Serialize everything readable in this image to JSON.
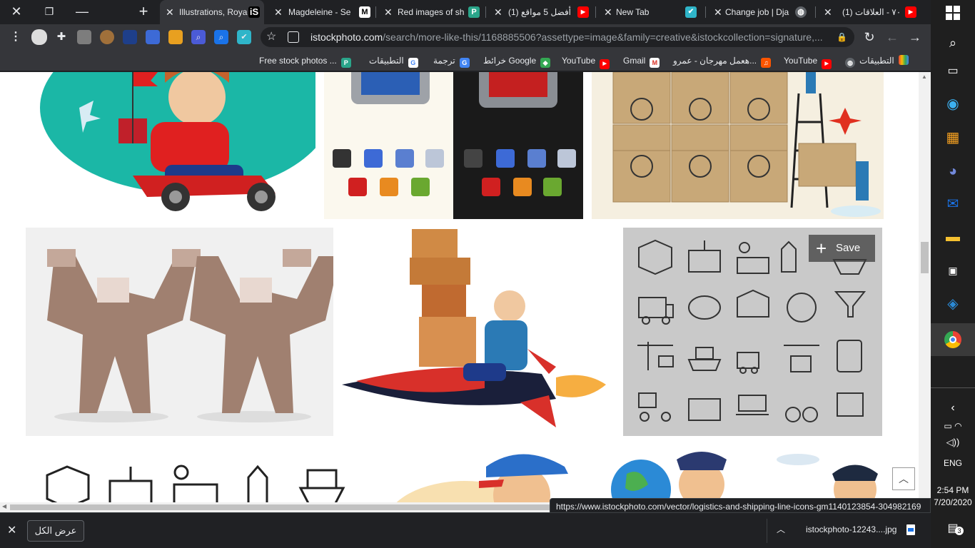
{
  "tabs": [
    {
      "label": "Illustrations, Roya",
      "favicon": "iS",
      "active": true
    },
    {
      "label": "Magdeleine - Se",
      "favicon": "M"
    },
    {
      "label": "Red images of sh",
      "favicon": "p"
    },
    {
      "label": "(1) أفضل 5 مواقع",
      "favicon": "youtube"
    },
    {
      "label": "New Tab",
      "favicon": "none"
    },
    {
      "label": "Change job | Dja",
      "favicon": "globe"
    },
    {
      "label": "(1) ٧٠ - العلاقات",
      "favicon": "youtube"
    }
  ],
  "toolbar": {
    "url_host": "istockphoto.com",
    "url_path": "/search/more-like-this/1168885506?assettype=image&family=creative&istockcollection=signature,..."
  },
  "bookmarks": [
    {
      "label": "Free stock photos ..."
    },
    {
      "label": "التطبيقات"
    },
    {
      "label": "ترجمة"
    },
    {
      "label": "خرائط Google"
    },
    {
      "label": "YouTube"
    },
    {
      "label": "Gmail"
    },
    {
      "label": "هعمل مهرجان - عمرو..."
    },
    {
      "label": "YouTube"
    },
    {
      "label": "التطبيقات"
    }
  ],
  "content": {
    "save_label": "Save",
    "status_url": "https://www.istockphoto.com/vector/logistics-and-shipping-line-icons-gm1140123854-304982169"
  },
  "shelf": {
    "show_all": "عرض الكل",
    "download_name": "istockphoto-12243....jpg"
  },
  "system": {
    "language": "ENG",
    "time": "2:54 PM",
    "date": "7/20/2020",
    "notification_count": "3"
  },
  "colors": {
    "accent": "#e02020",
    "teal": "#1bb7a6",
    "panel_gray": "#c9c9c9"
  }
}
